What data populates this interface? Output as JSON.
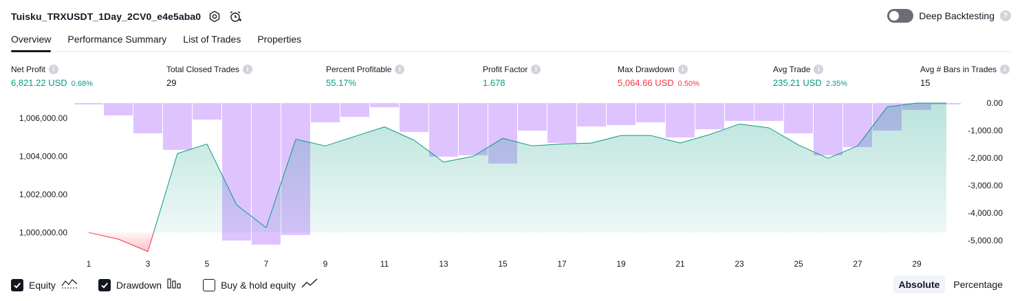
{
  "header": {
    "title": "Tuisku_TRXUSDT_1Day_2CV0_e4e5aba0",
    "deep_backtesting_label": "Deep Backtesting",
    "deep_backtesting_enabled": false,
    "help_glyph": "?"
  },
  "tabs": [
    {
      "label": "Overview",
      "active": true
    },
    {
      "label": "Performance Summary",
      "active": false
    },
    {
      "label": "List of Trades",
      "active": false
    },
    {
      "label": "Properties",
      "active": false
    }
  ],
  "metrics": [
    {
      "label": "Net Profit",
      "value": "6,821.22 USD",
      "pct": "0.68%",
      "color": "#089981"
    },
    {
      "label": "Total Closed Trades",
      "value": "29",
      "pct": "",
      "color": "#131722"
    },
    {
      "label": "Percent Profitable",
      "value": "55.17%",
      "pct": "",
      "color": "#089981"
    },
    {
      "label": "Profit Factor",
      "value": "1.678",
      "pct": "",
      "color": "#089981"
    },
    {
      "label": "Max Drawdown",
      "value": "5,064.66 USD",
      "pct": "0.50%",
      "color": "#f23645"
    },
    {
      "label": "Avg Trade",
      "value": "235.21 USD",
      "pct": "2.35%",
      "color": "#089981"
    },
    {
      "label": "Avg # Bars in Trades",
      "value": "15",
      "pct": "",
      "color": "#131722"
    }
  ],
  "legend": {
    "equity": {
      "label": "Equity",
      "checked": true
    },
    "drawdown": {
      "label": "Drawdown",
      "checked": true
    },
    "buy_hold": {
      "label": "Buy & hold equity",
      "checked": false
    }
  },
  "mode": {
    "absolute": "Absolute",
    "percentage": "Percentage",
    "selected": "Absolute"
  },
  "chart_data": {
    "type": "line",
    "x": [
      1,
      2,
      3,
      4,
      5,
      6,
      7,
      8,
      9,
      10,
      11,
      12,
      13,
      14,
      15,
      16,
      17,
      18,
      19,
      20,
      21,
      22,
      23,
      24,
      25,
      26,
      27,
      28,
      29,
      30
    ],
    "x_tick_labels": [
      "1",
      "3",
      "5",
      "7",
      "9",
      "11",
      "13",
      "15",
      "17",
      "19",
      "21",
      "23",
      "25",
      "27",
      "29"
    ],
    "left_axis": {
      "ylim": [
        999000,
        1006800
      ],
      "tick_labels": [
        "1,000,000.00",
        "1,002,000.00",
        "1,004,000.00",
        "1,006,000.00"
      ],
      "tick_values": [
        1000000,
        1002000,
        1004000,
        1006000
      ]
    },
    "right_axis": {
      "ylim": [
        -5400,
        0
      ],
      "tick_labels": [
        "0.00",
        "-1,000.00",
        "-2,000.00",
        "-3,000.00",
        "-4,000.00",
        "-5,000.00"
      ],
      "tick_values": [
        0,
        -1000,
        -2000,
        -3000,
        -4000,
        -5000
      ]
    },
    "baseline": 1000000,
    "series": [
      {
        "type": "area",
        "axis": "left",
        "values": [
          1000000,
          999650,
          999000,
          1004150,
          1004650,
          1001450,
          1000250,
          1004900,
          1004550,
          1005050,
          1005550,
          1004850,
          1003700,
          1004000,
          1004950,
          1004550,
          1004650,
          1004700,
          1005100,
          1005100,
          1004700,
          1005150,
          1005700,
          1005500,
          1004600,
          1003900,
          1004550,
          1006600,
          1006800,
          1006800
        ],
        "color_up": "#089981",
        "color_down": "#f23645"
      },
      {
        "type": "bar",
        "axis": "right",
        "values": [
          -50,
          -450,
          -1100,
          -1700,
          -600,
          -5000,
          -5150,
          -4800,
          -700,
          -500,
          -150,
          -1050,
          -1950,
          -1900,
          -2200,
          -1000,
          -1450,
          -850,
          -800,
          -700,
          -1250,
          -950,
          -650,
          -650,
          -1100,
          -1900,
          -1600,
          -1000,
          -250,
          -50
        ],
        "color": "#c592ff"
      }
    ]
  }
}
